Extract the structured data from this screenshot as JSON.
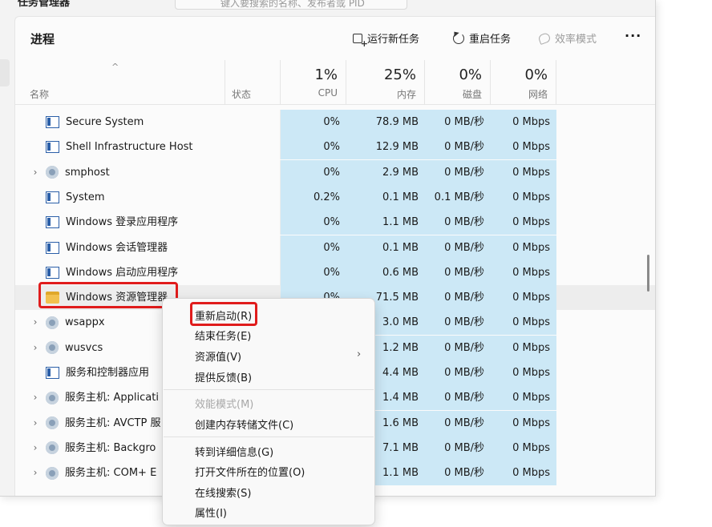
{
  "window": {
    "title": "任务管理器",
    "search_placeholder": "键入要搜索的名称、发布者或 PID"
  },
  "toolbar": {
    "heading": "进程",
    "run_new_task": "运行新任务",
    "restart_task": "重启任务",
    "efficiency_mode": "效率模式",
    "more": "···"
  },
  "columns": {
    "name": "名称",
    "status": "状态",
    "cpu_pct": "1%",
    "cpu": "CPU",
    "mem_pct": "25%",
    "mem": "内存",
    "disk_pct": "0%",
    "disk": "磁盘",
    "net_pct": "0%",
    "net": "网络"
  },
  "rows": [
    {
      "name": "Secure System",
      "expand": "",
      "icon": "window-icon",
      "cpu": "0%",
      "mem": "78.9 MB",
      "disk": "0 MB/秒",
      "net": "0 Mbps"
    },
    {
      "name": "Shell Infrastructure Host",
      "expand": "",
      "icon": "window-icon",
      "cpu": "0%",
      "mem": "12.9 MB",
      "disk": "0 MB/秒",
      "net": "0 Mbps"
    },
    {
      "name": "smphost",
      "expand": "›",
      "icon": "gear-icon",
      "cpu": "0%",
      "mem": "2.9 MB",
      "disk": "0 MB/秒",
      "net": "0 Mbps"
    },
    {
      "name": "System",
      "expand": "",
      "icon": "window-icon",
      "cpu": "0.2%",
      "mem": "0.1 MB",
      "disk": "0.1 MB/秒",
      "net": "0 Mbps"
    },
    {
      "name": "Windows 登录应用程序",
      "expand": "",
      "icon": "window-icon",
      "cpu": "0%",
      "mem": "1.1 MB",
      "disk": "0 MB/秒",
      "net": "0 Mbps"
    },
    {
      "name": "Windows 会话管理器",
      "expand": "",
      "icon": "window-icon",
      "cpu": "0%",
      "mem": "0.1 MB",
      "disk": "0 MB/秒",
      "net": "0 Mbps"
    },
    {
      "name": "Windows 启动应用程序",
      "expand": "",
      "icon": "window-icon",
      "cpu": "0%",
      "mem": "0.6 MB",
      "disk": "0 MB/秒",
      "net": "0 Mbps"
    },
    {
      "name": "Windows 资源管理器",
      "expand": "",
      "icon": "folder-icon",
      "cpu": "0%",
      "mem": "71.5 MB",
      "disk": "0 MB/秒",
      "net": "0 Mbps"
    },
    {
      "name": "wsappx",
      "expand": "›",
      "icon": "gear-icon",
      "cpu": "",
      "mem": "3.0 MB",
      "disk": "0 MB/秒",
      "net": "0 Mbps"
    },
    {
      "name": "wusvcs",
      "expand": "›",
      "icon": "gear-icon",
      "cpu": "",
      "mem": "1.2 MB",
      "disk": "0 MB/秒",
      "net": "0 Mbps"
    },
    {
      "name": "服务和控制器应用",
      "expand": "",
      "icon": "window-icon",
      "cpu": "",
      "mem": "4.4 MB",
      "disk": "0 MB/秒",
      "net": "0 Mbps"
    },
    {
      "name": "服务主机: Applicati",
      "expand": "›",
      "icon": "gear-icon",
      "cpu": "",
      "mem": "1.4 MB",
      "disk": "0 MB/秒",
      "net": "0 Mbps"
    },
    {
      "name": "服务主机: AVCTP 服",
      "expand": "›",
      "icon": "gear-icon",
      "cpu": "",
      "mem": "1.6 MB",
      "disk": "0 MB/秒",
      "net": "0 Mbps"
    },
    {
      "name": "服务主机: Backgro",
      "expand": "›",
      "icon": "gear-icon",
      "cpu": "",
      "mem": "7.1 MB",
      "disk": "0 MB/秒",
      "net": "0 Mbps"
    },
    {
      "name": "服务主机: COM+ E",
      "expand": "›",
      "icon": "gear-icon",
      "cpu": "",
      "mem": "1.1 MB",
      "disk": "0 MB/秒",
      "net": "0 Mbps"
    }
  ],
  "context_menu": {
    "restart": "重新启动(R)",
    "end_task": "结束任务(E)",
    "resource_values": "资源值(V)",
    "feedback": "提供反馈(B)",
    "efficiency_mode": "效能模式(M)",
    "create_dump": "创建内存转储文件(C)",
    "go_to_details": "转到详细信息(G)",
    "open_file_location": "打开文件所在的位置(O)",
    "search_online": "在线搜索(S)",
    "properties": "属性(I)",
    "submenu_arrow": "›"
  },
  "colors": {
    "highlight": "#e01c1c",
    "column_tint": "#cce8f6"
  }
}
